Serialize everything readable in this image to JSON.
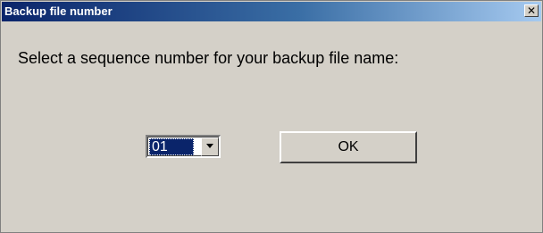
{
  "window": {
    "title": "Backup file number",
    "close_glyph": "✕"
  },
  "prompt": {
    "text": "Select a sequence number for your backup file name:"
  },
  "sequence_select": {
    "selected": "01"
  },
  "ok_button": {
    "label": "OK"
  },
  "colors": {
    "titlebar_start": "#0a246a",
    "titlebar_end": "#a6caf0",
    "dialog_bg": "#d4d0c8",
    "selection_bg": "#0a246a"
  },
  "icons": {
    "close": "close-icon",
    "dropdown": "chevron-down-icon"
  }
}
